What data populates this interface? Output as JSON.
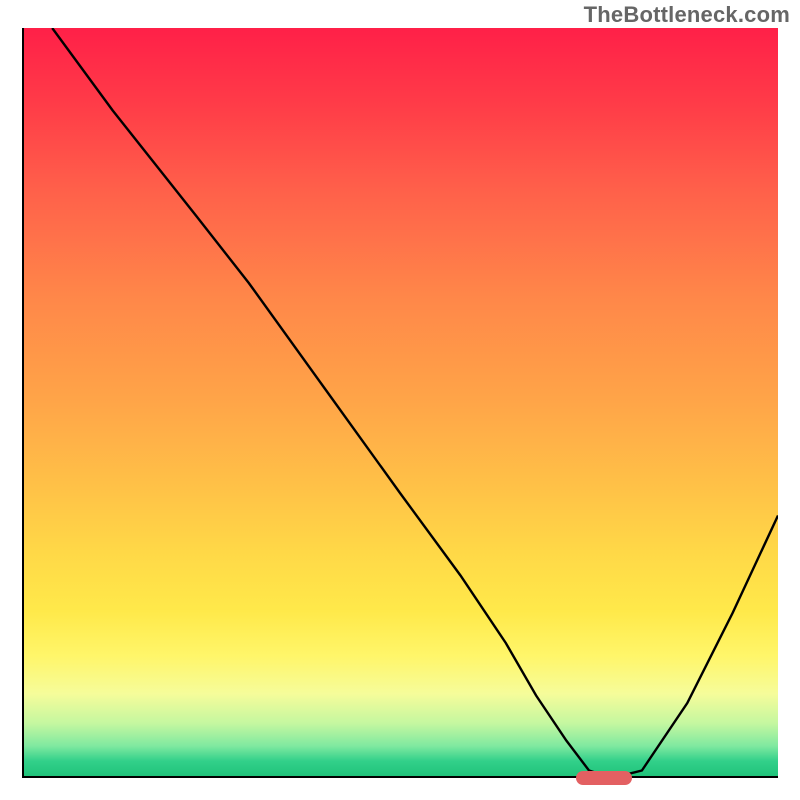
{
  "watermark": "TheBottleneck.com",
  "chart_data": {
    "type": "line",
    "title": "",
    "xlabel": "",
    "ylabel": "",
    "xlim": [
      0,
      100
    ],
    "ylim": [
      0,
      100
    ],
    "grid": false,
    "legend": false,
    "annotations": [],
    "axis_ticks_visible": false,
    "background_gradient": {
      "direction": "vertical",
      "stops": [
        {
          "pos": 0,
          "color": "#ff2048"
        },
        {
          "pos": 10,
          "color": "#ff3b48"
        },
        {
          "pos": 22,
          "color": "#ff614a"
        },
        {
          "pos": 36,
          "color": "#ff8749"
        },
        {
          "pos": 50,
          "color": "#ffa548"
        },
        {
          "pos": 62,
          "color": "#ffc347"
        },
        {
          "pos": 70,
          "color": "#ffd847"
        },
        {
          "pos": 78,
          "color": "#ffe94a"
        },
        {
          "pos": 84,
          "color": "#fff66a"
        },
        {
          "pos": 89,
          "color": "#f6fc9a"
        },
        {
          "pos": 93,
          "color": "#c4f7a0"
        },
        {
          "pos": 96,
          "color": "#7fe9a0"
        },
        {
          "pos": 98,
          "color": "#32d08a"
        },
        {
          "pos": 100,
          "color": "#20c37a"
        }
      ]
    },
    "series": [
      {
        "name": "bottleneck-curve",
        "x": [
          4,
          12,
          23,
          30,
          40,
          50,
          58,
          64,
          68,
          72,
          75,
          78,
          82,
          88,
          94,
          100
        ],
        "y": [
          100,
          89,
          75,
          66,
          52,
          38,
          27,
          18,
          11,
          5,
          1,
          0,
          1,
          10,
          22,
          35
        ]
      }
    ],
    "optimal_marker": {
      "x": 77,
      "y": 0,
      "color": "#e36062"
    }
  }
}
